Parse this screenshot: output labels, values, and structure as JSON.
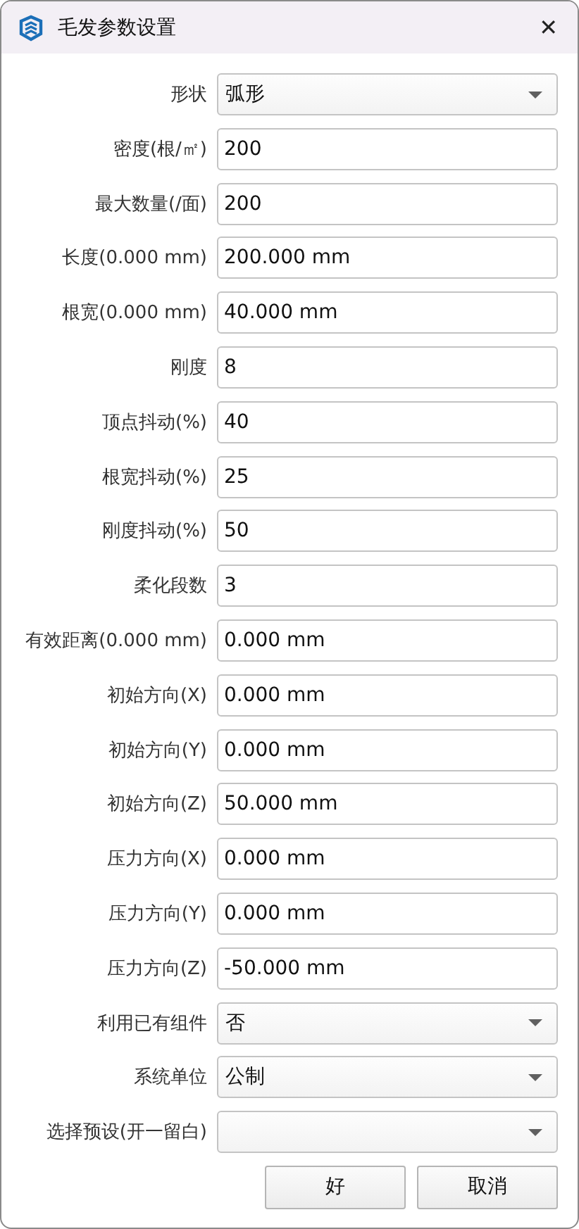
{
  "window": {
    "title": "毛发参数设置",
    "close": "✕"
  },
  "rows": [
    {
      "label": "形状",
      "kind": "dropdown",
      "value": "弧形"
    },
    {
      "label": "密度(根/㎡)",
      "kind": "text",
      "value": "200"
    },
    {
      "label": "最大数量(/面)",
      "kind": "text",
      "value": "200"
    },
    {
      "label": "长度(0.000 mm)",
      "kind": "text",
      "value": "200.000 mm"
    },
    {
      "label": "根宽(0.000 mm)",
      "kind": "text",
      "value": "40.000 mm"
    },
    {
      "label": "刚度",
      "kind": "text",
      "value": "8"
    },
    {
      "label": "顶点抖动(%)",
      "kind": "text",
      "value": "40"
    },
    {
      "label": "根宽抖动(%)",
      "kind": "text",
      "value": "25"
    },
    {
      "label": "刚度抖动(%)",
      "kind": "text",
      "value": "50"
    },
    {
      "label": "柔化段数",
      "kind": "text",
      "value": "3"
    },
    {
      "label": "有效距离(0.000 mm)",
      "kind": "text",
      "value": "0.000 mm"
    },
    {
      "label": "初始方向(X)",
      "kind": "text",
      "value": "0.000 mm"
    },
    {
      "label": "初始方向(Y)",
      "kind": "text",
      "value": "0.000 mm"
    },
    {
      "label": "初始方向(Z)",
      "kind": "text",
      "value": "50.000 mm"
    },
    {
      "label": "压力方向(X)",
      "kind": "text",
      "value": "0.000 mm"
    },
    {
      "label": "压力方向(Y)",
      "kind": "text",
      "value": "0.000 mm"
    },
    {
      "label": "压力方向(Z)",
      "kind": "text",
      "value": "-50.000 mm"
    },
    {
      "label": "利用已有组件",
      "kind": "dropdown",
      "value": "否"
    },
    {
      "label": "系统单位",
      "kind": "dropdown",
      "value": "公制"
    },
    {
      "label": "选择预设(开一留白)",
      "kind": "dropdown"
    }
  ],
  "buttons": [
    "好",
    "取消"
  ]
}
